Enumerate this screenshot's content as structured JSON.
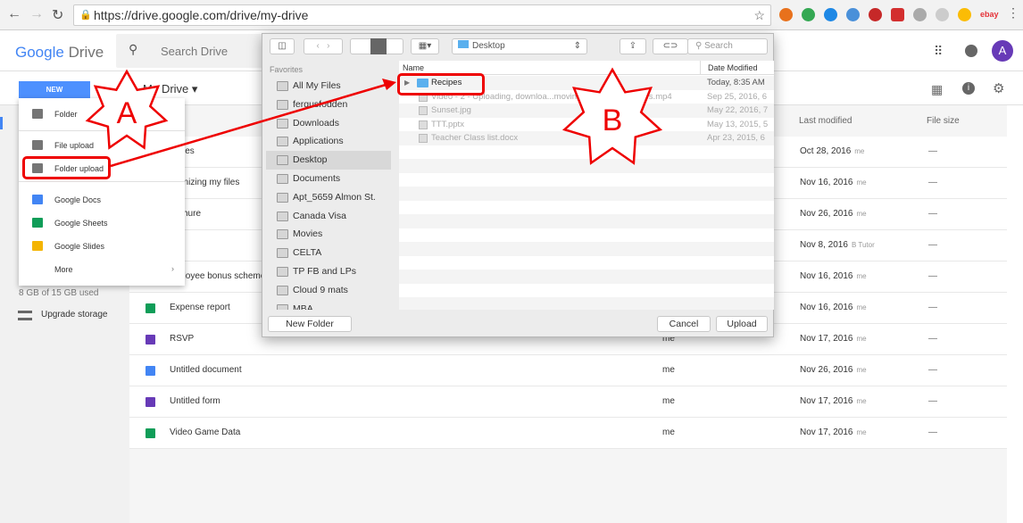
{
  "browser": {
    "url": "https://drive.google.com/drive/my-drive",
    "back": "←",
    "forward": "→",
    "reload": "↻"
  },
  "header": {
    "logo_google": "Google",
    "logo_drive": "Drive",
    "search_placeholder": "Search Drive",
    "avatar": "A"
  },
  "toolbar": {
    "new_label": "NEW",
    "location": "My Drive"
  },
  "new_menu": {
    "items": [
      {
        "label": "Folder",
        "color": "#757575"
      },
      {
        "label": "File upload",
        "color": "#757575"
      },
      {
        "label": "Folder upload",
        "color": "#757575"
      },
      {
        "label": "Google Docs",
        "color": "#4285f4"
      },
      {
        "label": "Google Sheets",
        "color": "#0f9d58"
      },
      {
        "label": "Google Slides",
        "color": "#f4b400"
      },
      {
        "label": "More",
        "color": ""
      }
    ]
  },
  "sidebar": {
    "storage": "8 GB of 15 GB used",
    "upgrade": "Upgrade storage"
  },
  "columns": {
    "last_modified": "Last modified",
    "file_size": "File size"
  },
  "files": [
    {
      "name": "files",
      "owner": "",
      "date": "Oct 28, 2016",
      "by": "me",
      "size": "—",
      "color": "#4285f4"
    },
    {
      "name": "anizing my files",
      "owner": "",
      "date": "Nov 16, 2016",
      "by": "me",
      "size": "—",
      "color": "#4285f4"
    },
    {
      "name": "chure",
      "owner": "",
      "date": "Nov 26, 2016",
      "by": "me",
      "size": "—",
      "color": "#4285f4"
    },
    {
      "name": "a",
      "owner": "",
      "date": "Nov 8, 2016",
      "by": "B Tutor",
      "size": "—",
      "color": "#4285f4"
    },
    {
      "name": "ployee bonus scheme",
      "owner": "",
      "date": "Nov 16, 2016",
      "by": "me",
      "size": "—",
      "color": "#0f9d58"
    },
    {
      "name": "Expense report",
      "owner": "me",
      "date": "Nov 16, 2016",
      "by": "me",
      "size": "—",
      "color": "#0f9d58"
    },
    {
      "name": "RSVP",
      "owner": "me",
      "date": "Nov 17, 2016",
      "by": "me",
      "size": "—",
      "color": "#673ab7"
    },
    {
      "name": "Untitled document",
      "owner": "me",
      "date": "Nov 26, 2016",
      "by": "me",
      "size": "—",
      "color": "#4285f4"
    },
    {
      "name": "Untitled form",
      "owner": "me",
      "date": "Nov 17, 2016",
      "by": "me",
      "size": "—",
      "color": "#673ab7"
    },
    {
      "name": "Video Game Data",
      "owner": "me",
      "date": "Nov 17, 2016",
      "by": "me",
      "size": "—",
      "color": "#0f9d58"
    }
  ],
  "dialog": {
    "location": "Desktop",
    "search": "Search",
    "favorites_heading": "Favorites",
    "sidebar": [
      "All My Files",
      "fergusfodden",
      "Downloads",
      "Applications",
      "Desktop",
      "Documents",
      "Apt_5659 Almon St.",
      "Canada Visa",
      "Movies",
      "CELTA",
      "TP FB and LPs",
      "Cloud 9 mats",
      "MBA"
    ],
    "col_name": "Name",
    "col_date": "Date Modified",
    "files": [
      {
        "name": "Recipes",
        "date": "Today, 8:35 AM"
      },
      {
        "name": "Video - 2 - Uploading, downloa...moving, and restoring files.mp4",
        "date": "Sep 25, 2016, 6"
      },
      {
        "name": "Sunset.jpg",
        "date": "May 22, 2016, 7"
      },
      {
        "name": "TTT.pptx",
        "date": "May 13, 2015, 5"
      },
      {
        "name": "Teacher Class list.docx",
        "date": "Apr 23, 2015, 6"
      }
    ],
    "new_folder": "New Folder",
    "cancel": "Cancel",
    "upload": "Upload"
  },
  "annotations": {
    "a": "A",
    "b": "B",
    "color": "#e00000"
  }
}
